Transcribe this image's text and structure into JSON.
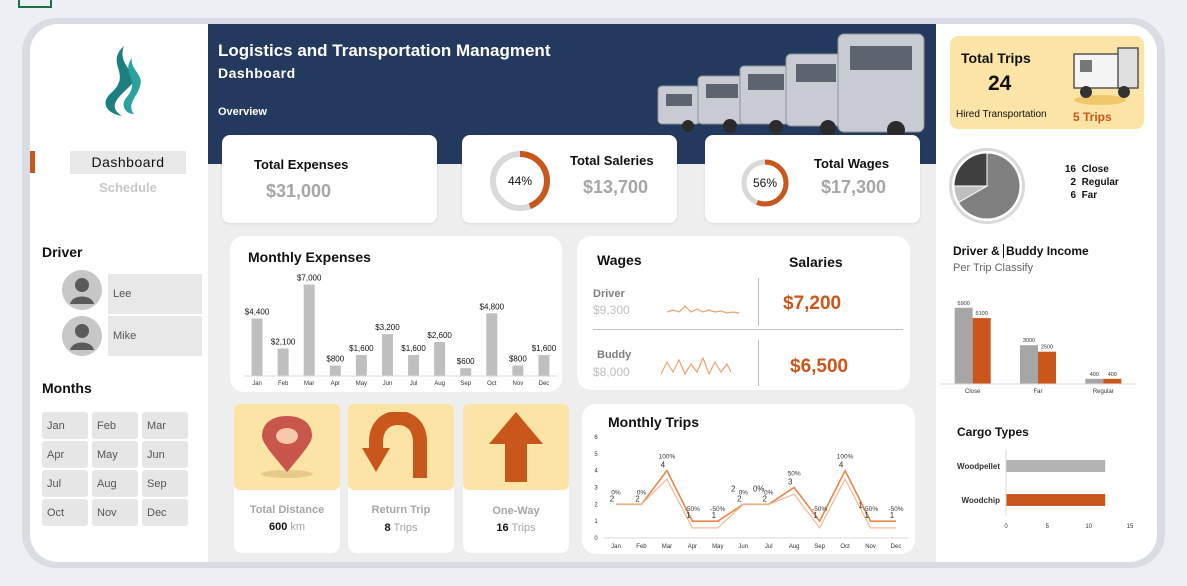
{
  "header": {
    "title": "Logistics and Transportation Managment",
    "subtitle": "Dashboard",
    "section": "Overview"
  },
  "nav": {
    "dashboard": "Dashboard",
    "schedule": "Schedule"
  },
  "drivers": {
    "title": "Driver",
    "items": [
      "Lee",
      "Mike"
    ]
  },
  "months": {
    "title": "Months",
    "items": [
      "Jan",
      "Feb",
      "Mar",
      "Apr",
      "May",
      "Jun",
      "Jul",
      "Aug",
      "Sep",
      "Oct",
      "Nov",
      "Dec"
    ]
  },
  "kpis": {
    "total_expenses": {
      "label": "Total Expenses",
      "value": "$31,000"
    },
    "total_salaries": {
      "label": "Total Saleries",
      "value": "$13,700",
      "percent": "44%",
      "fraction": 0.44
    },
    "total_wages": {
      "label": "Total Wages",
      "value": "$17,300",
      "percent": "56%",
      "fraction": 0.56
    }
  },
  "wages_salaries": {
    "wages_label": "Wages",
    "salaries_label": "Salaries",
    "driver": {
      "label": "Driver",
      "amount": "$9,300",
      "value": "$7,200"
    },
    "buddy": {
      "label": "Buddy",
      "amount": "$8,000",
      "value": "$6,500"
    }
  },
  "tiles": {
    "distance": {
      "label": "Total Distance",
      "value": "600",
      "unit": "km"
    },
    "return_trip": {
      "label": "Return Trip",
      "value": "8",
      "unit": "Trips"
    },
    "one_way": {
      "label": "One-Way",
      "value": "16",
      "unit": "Trips"
    }
  },
  "right": {
    "total_trips_label": "Total Trips",
    "total_trips_value": "24",
    "hired_label": "Hired Transportation",
    "hired_value": "5 Trips",
    "pie_legend": [
      {
        "count": "16",
        "label": "Close"
      },
      {
        "count": "2",
        "label": "Regular"
      },
      {
        "count": "6",
        "label": "Far"
      }
    ],
    "income_title_a": "Driver &",
    "income_title_b": "Buddy Income",
    "income_sub": "Per Trip Classify",
    "cargo_title": "Cargo Types"
  },
  "colors": {
    "navy": "#23395d",
    "orange": "#c9561a",
    "grey": "#b3b3b3",
    "cream": "#fbe4a6"
  },
  "chart_data": [
    {
      "type": "bar",
      "title": "Monthly Expenses",
      "categories": [
        "Jan",
        "Feb",
        "Mar",
        "Apr",
        "May",
        "Jun",
        "Jul",
        "Aug",
        "Sep",
        "Oct",
        "Nov",
        "Dec"
      ],
      "values": [
        4400,
        2100,
        7000,
        800,
        1600,
        3200,
        1600,
        2600,
        600,
        4800,
        800,
        1600
      ],
      "labels": [
        "$4,400",
        "$2,100",
        "$7,000",
        "$800",
        "$1,600",
        "$3,200",
        "$1,600",
        "$2,600",
        "$600",
        "$4,800",
        "$800",
        "$1,600"
      ],
      "ylim": [
        0,
        7500
      ]
    },
    {
      "type": "line",
      "title": "Monthly Trips",
      "categories": [
        "Jan",
        "Feb",
        "Mar",
        "Apr",
        "May",
        "Jun",
        "Jul",
        "Aug",
        "Sep",
        "Oct",
        "Nov",
        "Dec"
      ],
      "yticks": [
        "0",
        "1",
        "2",
        "3",
        "4",
        "5",
        "6"
      ],
      "ylim": [
        0,
        6
      ],
      "series": [
        {
          "values": [
            2,
            2,
            4,
            1,
            1,
            2,
            2,
            3,
            1,
            4,
            1,
            1
          ]
        },
        {
          "values": [
            2,
            2,
            3.5,
            0.6,
            0.6,
            2,
            2,
            2.6,
            0.6,
            3.5,
            0.6,
            0.6
          ]
        }
      ],
      "point_labels": [
        "2",
        "2",
        "4",
        "1",
        "1",
        "2",
        "2",
        "3",
        "1",
        "4",
        "1",
        "1"
      ],
      "pct_labels": [
        "0%",
        "0%",
        "100%",
        "-50%",
        "-50%",
        "0%",
        "0%",
        "50%",
        "-50%",
        "100%",
        "-50%",
        "-50%"
      ],
      "extra_labels": [
        {
          "month": "Jun",
          "text": "2"
        },
        {
          "month": "Jul",
          "text": "0%"
        },
        {
          "month": "Nov",
          "text": "1"
        }
      ]
    },
    {
      "type": "pie",
      "values": [
        16,
        2,
        6
      ],
      "categories": [
        "Close",
        "Regular",
        "Far"
      ],
      "colors": [
        "#808080",
        "#bfbfbf",
        "#404040"
      ]
    },
    {
      "type": "bar",
      "title": "Driver & Buddy Income",
      "categories": [
        "Close",
        "Far",
        "Regular"
      ],
      "series": [
        {
          "values": [
            5900,
            3000,
            400
          ],
          "color": "#a6a6a6"
        },
        {
          "values": [
            5100,
            2500,
            400
          ],
          "color": "#c9561a"
        }
      ],
      "ylim": [
        0,
        6500
      ]
    },
    {
      "type": "bar",
      "title": "Cargo Types",
      "categories": [
        "Woodpellet",
        "Woodchip"
      ],
      "values": [
        12,
        12
      ],
      "colors": [
        "#b3b3b3",
        "#c9561a"
      ],
      "xticks": [
        "0",
        "5",
        "10",
        "15"
      ],
      "xlim": [
        0,
        15
      ]
    }
  ]
}
